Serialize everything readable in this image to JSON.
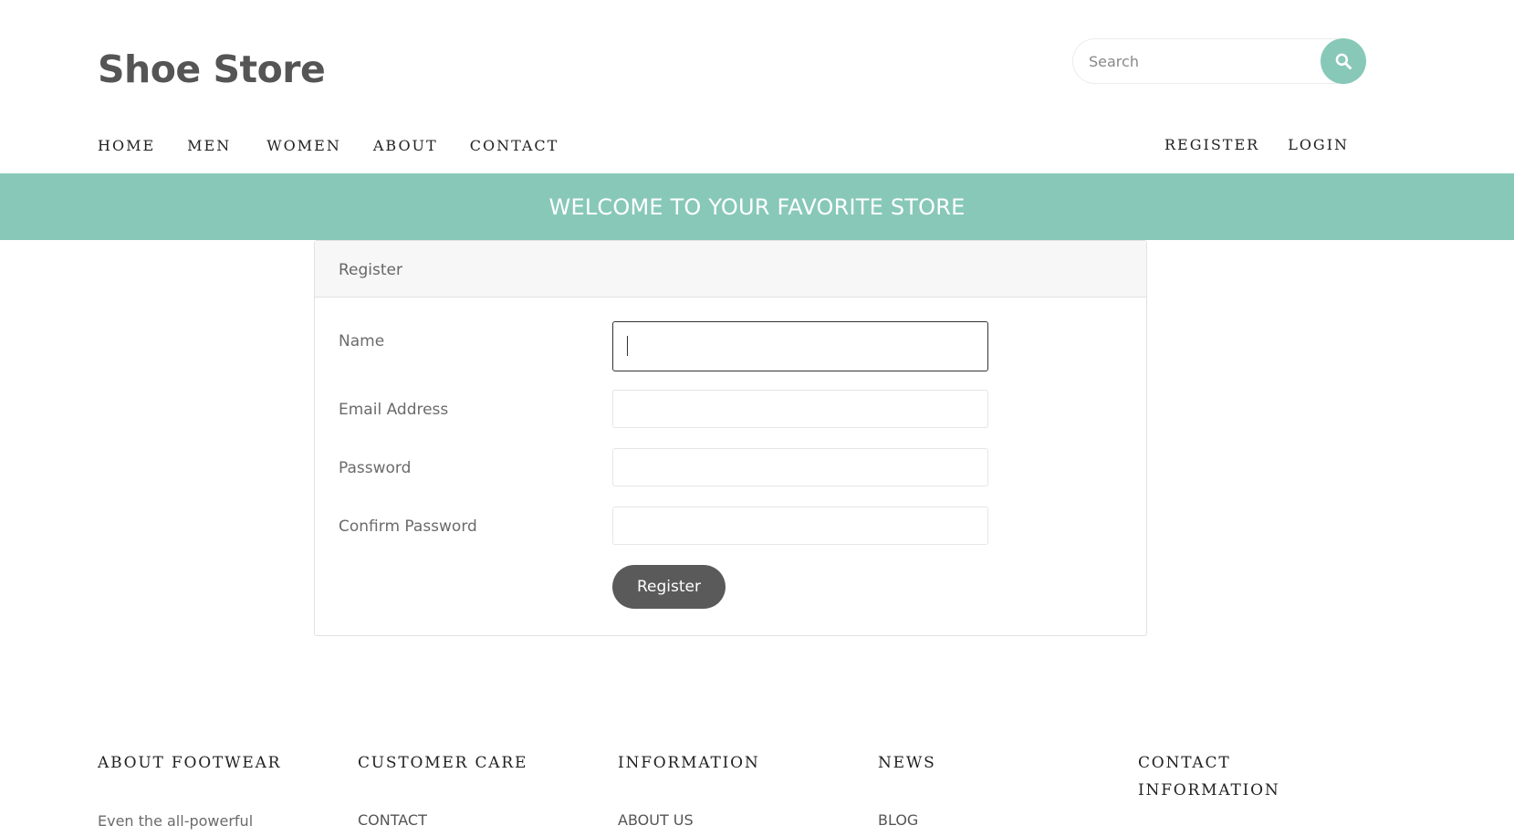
{
  "header": {
    "logo": "Shoe Store",
    "search": {
      "placeholder": "Search",
      "value": ""
    }
  },
  "nav": {
    "left": [
      "HOME",
      "MEN",
      "WOMEN",
      "ABOUT",
      "CONTACT"
    ],
    "right": [
      "REGISTER",
      "LOGIN"
    ]
  },
  "banner": {
    "text": "WELCOME TO YOUR FAVORITE STORE"
  },
  "register_form": {
    "title": "Register",
    "fields": [
      {
        "label": "Name",
        "value": ""
      },
      {
        "label": "Email Address",
        "value": ""
      },
      {
        "label": "Password",
        "value": ""
      },
      {
        "label": "Confirm Password",
        "value": ""
      }
    ],
    "submit_label": "Register"
  },
  "footer": {
    "columns": [
      {
        "heading": "ABOUT FOOTWEAR",
        "body": "Even the all-powerful"
      },
      {
        "heading": "CUSTOMER CARE",
        "link": "CONTACT"
      },
      {
        "heading": "INFORMATION",
        "link": "ABOUT US"
      },
      {
        "heading": "NEWS",
        "link": "BLOG"
      },
      {
        "heading": "CONTACT INFORMATION"
      }
    ]
  },
  "colors": {
    "accent": "#88c8b9",
    "button_dark": "#5a5a5a",
    "text_dark": "#555555"
  },
  "icons": {
    "search_button": "search-icon"
  }
}
